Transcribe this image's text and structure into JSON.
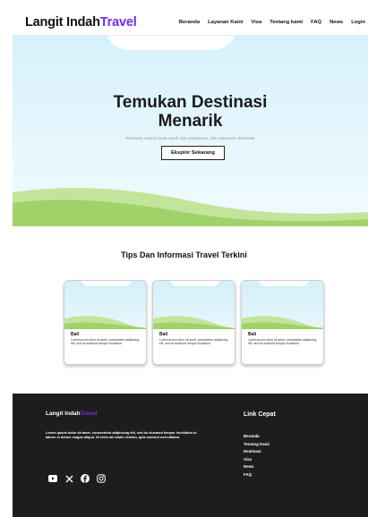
{
  "header": {
    "brand_part1": "Langit Indah",
    "brand_part2": "Travel",
    "nav": [
      "Beranda",
      "Layanan Kami",
      "Visa",
      "Tentang kami",
      "FAQ",
      "News",
      "Login"
    ]
  },
  "hero": {
    "title_line1": "Temukan Destinasi",
    "title_line2": "Menarik",
    "subtitle": "Panduan utama Anda untuk tips perjalanan, dan wawasan destinasi",
    "cta": "Eksplor Sekarang"
  },
  "tips": {
    "title": "Tips Dan Informasi Travel Terkini",
    "cards": [
      {
        "title": "Bali",
        "text": "Lorem ipsum dolor sit amet, consectetur adipiscing elit, sed do eiusmod tempor incididunt"
      },
      {
        "title": "Bali",
        "text": "Lorem ipsum dolor sit amet, consectetur adipiscing elit, sed do eiusmod tempor incididunt"
      },
      {
        "title": "Bali",
        "text": "Lorem ipsum dolor sit amet, consectetur adipiscing elit, sed do eiusmod tempor incididunt"
      }
    ]
  },
  "footer": {
    "brand_part1": "Langit Indah",
    "brand_part2": "Travel",
    "description": "Lorem ipsum dolor sit amet, consectetur adipiscing elit, sed do eiusmod tempor incididunt ut labore et dolore magna aliqua. Ut enim ad minim veniam, quis nostrud exercitation.",
    "socials": [
      "youtube-icon",
      "x-icon",
      "facebook-icon",
      "instagram-icon"
    ],
    "links_title": "Link Cepat",
    "links": [
      "Beranda",
      "Tentang Kami",
      "Destinasi",
      "Visa",
      "News",
      "FAQ"
    ]
  },
  "colors": {
    "accent": "#6f2cf0",
    "sky": "#d6f1fb",
    "grass": "#9fd36a",
    "footer_bg": "#1d1d1d"
  }
}
